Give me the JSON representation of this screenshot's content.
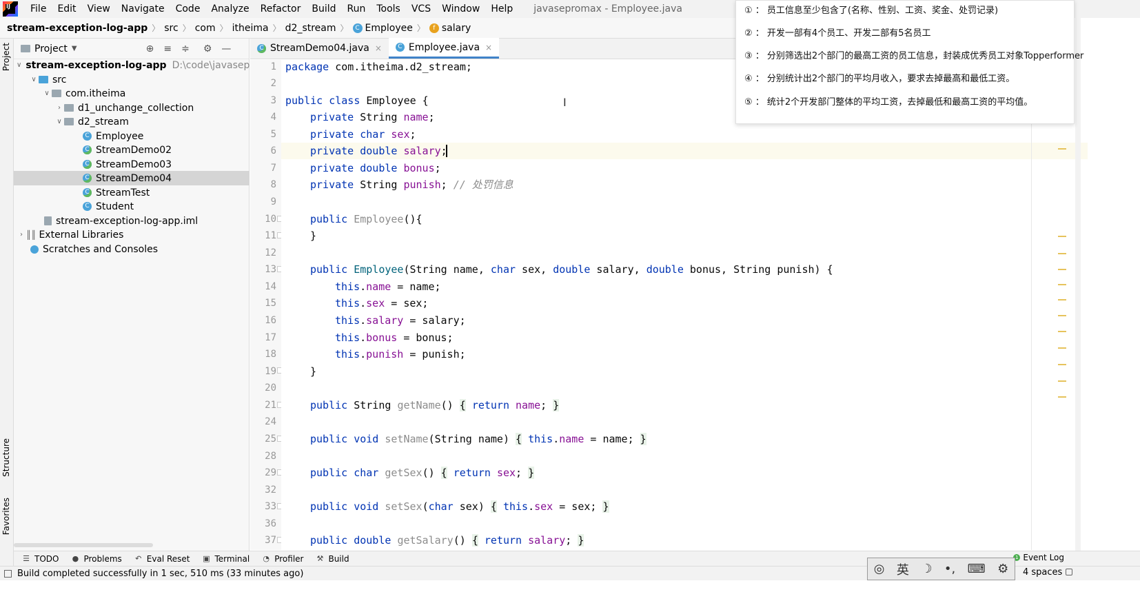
{
  "menubar": {
    "items": [
      "File",
      "Edit",
      "View",
      "Navigate",
      "Code",
      "Analyze",
      "Refactor",
      "Build",
      "Run",
      "Tools",
      "VCS",
      "Window",
      "Help"
    ],
    "window_title": "javasepromax - Employee.java"
  },
  "breadcrumb": {
    "project": "stream-exception-log-app",
    "src": "src",
    "com": "com",
    "itheima": "itheima",
    "pkg": "d2_stream",
    "class": "Employee",
    "field": "salary"
  },
  "left_strip": {
    "project": "Project",
    "structure": "Structure",
    "favorites": "Favorites"
  },
  "project_panel": {
    "title": "Project",
    "tree": [
      {
        "label": "stream-exception-log-app",
        "extra": "D:\\code\\javasepro"
      },
      {
        "label": "src"
      },
      {
        "label": "com.itheima"
      },
      {
        "label": "d1_unchange_collection"
      },
      {
        "label": "d2_stream"
      },
      {
        "label": "Employee"
      },
      {
        "label": "StreamDemo02"
      },
      {
        "label": "StreamDemo03"
      },
      {
        "label": "StreamDemo04"
      },
      {
        "label": "StreamTest"
      },
      {
        "label": "Student"
      },
      {
        "label": "stream-exception-log-app.iml"
      },
      {
        "label": "External Libraries"
      },
      {
        "label": "Scratches and Consoles"
      }
    ]
  },
  "editor": {
    "tabs": [
      {
        "label": "StreamDemo04.java"
      },
      {
        "label": "Employee.java"
      }
    ],
    "line_numbers": [
      "1",
      "2",
      "3",
      "4",
      "5",
      "6",
      "7",
      "8",
      "9",
      "10",
      "11",
      "12",
      "13",
      "14",
      "15",
      "16",
      "17",
      "18",
      "19",
      "20",
      "21",
      "24",
      "25",
      "28",
      "29",
      "32",
      "33",
      "36",
      "37"
    ]
  },
  "notes": [
    "① ： 员工信息至少包含了(名称、性别、工资、奖金、处罚记录)",
    "② ： 开发一部有4个员工、开发二部有5名员工",
    "③ ： 分别筛选出2个部门的最高工资的员工信息，封装成优秀员工对象Topperformer",
    "④ ： 分别统计出2个部门的平均月收入，要求去掉最高和最低工资。",
    "⑤ ： 统计2个开发部门整体的平均工资，去掉最低和最高工资的平均值。"
  ],
  "bottom_tools": {
    "todo": "TODO",
    "problems": "Problems",
    "eval_reset": "Eval Reset",
    "terminal": "Terminal",
    "profiler": "Profiler",
    "build": "Build",
    "event_log": "Event Log"
  },
  "status": {
    "message": "Build completed successfully in 1 sec, 510 ms (33 minutes ago)",
    "indent": "4 spaces",
    "ime_label": "英"
  },
  "colors": {
    "keyword": "#0033b3",
    "field": "#871094",
    "method": "#00627a",
    "comment": "#8c8c8c",
    "selection": "#d5d5d5",
    "tab_underline": "#4083c9"
  }
}
